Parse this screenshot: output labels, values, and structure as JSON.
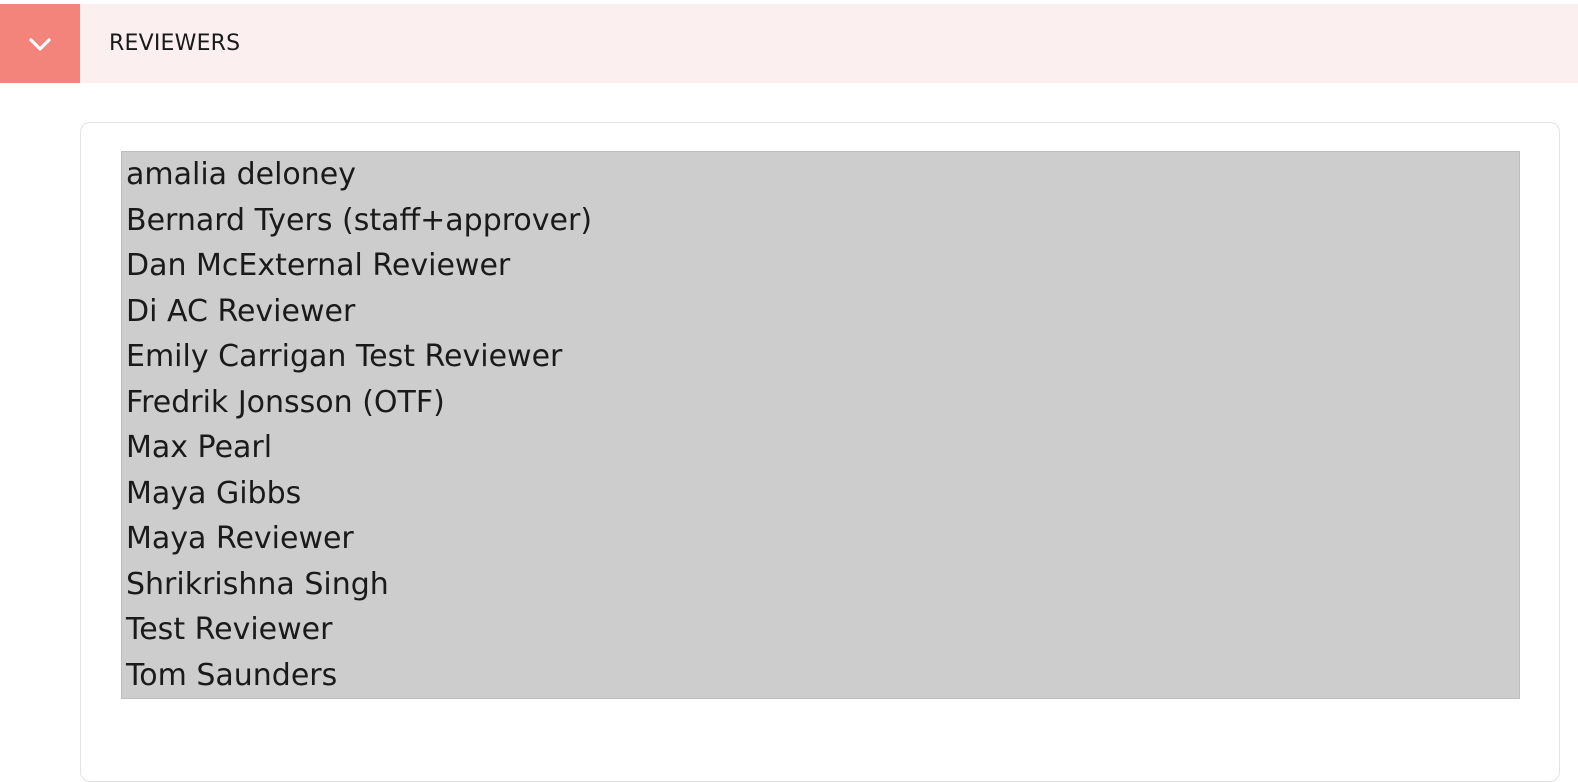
{
  "section": {
    "title": "REVIEWERS",
    "toggle_icon": "chevron-down-icon",
    "accent_color": "#f2847c",
    "header_background": "#fbefef"
  },
  "reviewers": [
    "amalia deloney",
    "Bernard Tyers (staff+approver)",
    "Dan McExternal Reviewer",
    "Di AC Reviewer",
    "Emily Carrigan Test Reviewer",
    "Fredrik Jonsson (OTF)",
    "Max Pearl",
    "Maya Gibbs",
    "Maya Reviewer",
    "Shrikrishna Singh",
    "Test Reviewer",
    "Tom Saunders"
  ]
}
